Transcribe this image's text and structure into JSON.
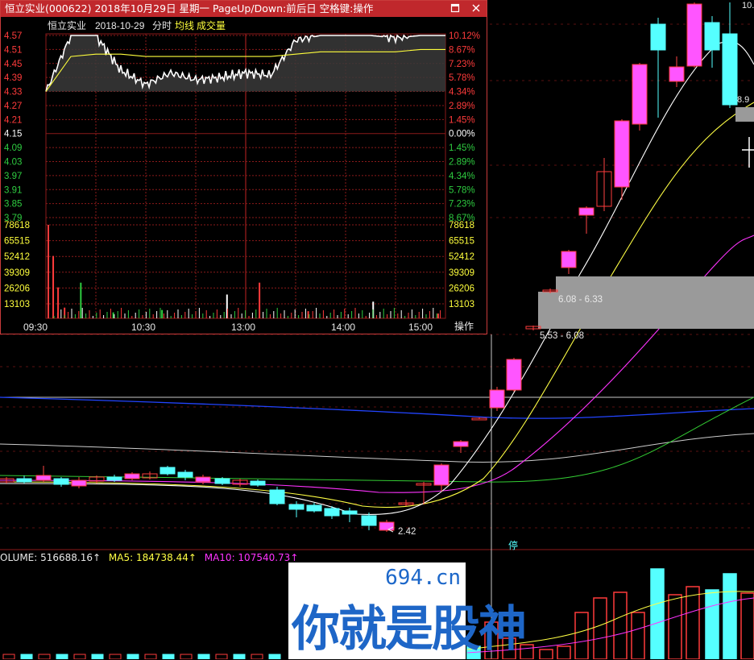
{
  "popup": {
    "title": "恒立实业(000622)  2018年10月29日  星期一  PageUp/Down:前后日  空格键:操作",
    "stock_name": "恒立实业",
    "date": "2018-10-29",
    "mode_label": "分时",
    "avg_label": "均线",
    "vol_label": "成交量",
    "operate_label": "操作",
    "restore_icon": "restore-icon",
    "close_icon": "close-icon",
    "price_ticks": [
      "4.57",
      "4.51",
      "4.45",
      "4.39",
      "4.33",
      "4.27",
      "4.21",
      "4.15",
      "4.09",
      "4.03",
      "3.97",
      "3.91",
      "3.85",
      "3.79"
    ],
    "pct_ticks": [
      "10.12%",
      "8.67%",
      "7.23%",
      "5.78%",
      "4.34%",
      "2.89%",
      "1.45%",
      "0.00%",
      "1.45%",
      "2.89%",
      "4.34%",
      "5.78%",
      "7.23%",
      "8.67%"
    ],
    "vol_ticks": [
      "78618",
      "65515",
      "52412",
      "39309",
      "26206",
      "13103"
    ],
    "time_ticks": [
      "09:30",
      "10:30",
      "13:00",
      "14:00",
      "15:00"
    ],
    "colors": {
      "up": "#ff3b3b",
      "down": "#2ecc40",
      "flat": "#ffffff",
      "avg": "#ffff3c",
      "grid": "#8b1a1a"
    }
  },
  "main": {
    "annotations": [
      "6.08 - 6.33",
      "5.53 - 6.08",
      "2.42",
      "8.9",
      "10."
    ],
    "stop_label": "停",
    "colors": {
      "up": "#ff55ff",
      "down": "#55ffff",
      "ma5": "#ffffff",
      "ma10": "#ffff44",
      "ma20": "#ff33ff",
      "ma30": "#33cc33",
      "ma60": "#cccccc",
      "ma120": "#2244ff"
    }
  },
  "volume_legend": {
    "vol": "OLUME: 516688.16↑",
    "ma5": "MA5: 184738.44↑",
    "ma10": "MA10: 107540.73↑"
  },
  "watermark": {
    "url": "694.cn",
    "text": "你就是股神"
  },
  "chart_data": [
    {
      "type": "line",
      "title": "恒立实业 2018-10-29 分时",
      "xlabel": "",
      "ylabel": "",
      "x": [
        "09:30",
        "09:45",
        "10:00",
        "10:15",
        "10:30",
        "10:45",
        "11:00",
        "11:15",
        "11:30",
        "13:15",
        "13:30",
        "13:45",
        "14:00",
        "14:15",
        "14:30",
        "14:45",
        "15:00"
      ],
      "series": [
        {
          "name": "分时",
          "values": [
            4.33,
            4.57,
            4.57,
            4.42,
            4.36,
            4.41,
            4.38,
            4.39,
            4.41,
            4.4,
            4.55,
            4.57,
            4.57,
            4.57,
            4.56,
            4.57,
            4.57
          ]
        },
        {
          "name": "均线",
          "values": [
            4.33,
            4.48,
            4.49,
            4.49,
            4.48,
            4.48,
            4.48,
            4.48,
            4.48,
            4.48,
            4.49,
            4.5,
            4.5,
            4.5,
            4.5,
            4.51,
            4.51
          ]
        }
      ],
      "ylim": [
        3.76,
        4.57
      ],
      "prev_close": 4.15
    },
    {
      "type": "bar",
      "title": "成交量",
      "xlabel": "",
      "ylabel": "",
      "x": [
        "09:30",
        "09:35",
        "09:40",
        "09:45",
        "10:00",
        "10:30",
        "11:00",
        "13:15",
        "13:30",
        "14:00",
        "14:30",
        "15:00"
      ],
      "values": [
        78618,
        52412,
        26000,
        9000,
        30000,
        5000,
        7000,
        20000,
        30000,
        6000,
        14000,
        4000
      ],
      "ylim": [
        0,
        78618
      ]
    }
  ]
}
